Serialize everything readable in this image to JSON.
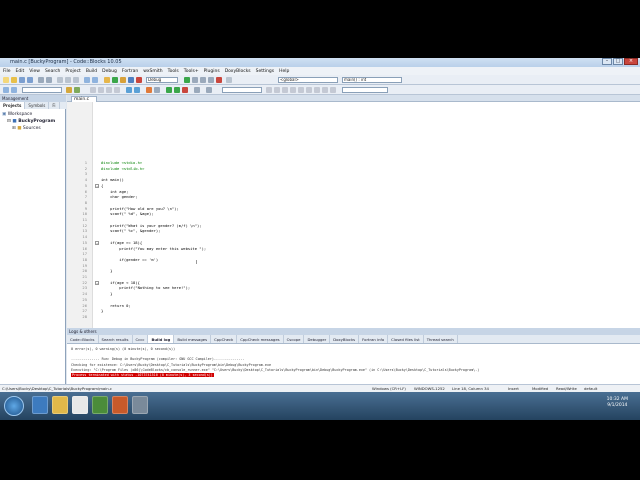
{
  "window": {
    "title": "main.c [BuckyProgram] - Code::Blocks 10.05"
  },
  "menu": [
    "File",
    "Edit",
    "View",
    "Search",
    "Project",
    "Build",
    "Debug",
    "Fortran",
    "wxSmith",
    "Tools",
    "Tools+",
    "Plugins",
    "DoxyBlocks",
    "Settings",
    "Help"
  ],
  "toolbar": {
    "build_target": "Debug",
    "scope": "<global>",
    "function": "main() : int"
  },
  "management": {
    "title": "Management",
    "tabs": [
      "Projects",
      "Symbols",
      "Fi"
    ],
    "workspace": "Workspace",
    "project": "BuckyProgram",
    "folder": "Sources"
  },
  "editor": {
    "file_tab": "main.c",
    "lines": [
      {
        "n": "1",
        "text": "#include <stdio.h>",
        "cls": "pp"
      },
      {
        "n": "2",
        "text": "#include <stdlib.h>",
        "cls": "pp"
      },
      {
        "n": "3",
        "text": "",
        "cls": ""
      },
      {
        "n": "4",
        "text": "int main()",
        "cls": ""
      },
      {
        "n": "5",
        "text": "{",
        "cls": ""
      },
      {
        "n": "6",
        "text": "    int age;",
        "cls": ""
      },
      {
        "n": "7",
        "text": "    char gender;",
        "cls": ""
      },
      {
        "n": "8",
        "text": "",
        "cls": ""
      },
      {
        "n": "9",
        "text": "    printf(\"How old are you? \\n\");",
        "cls": ""
      },
      {
        "n": "10",
        "text": "    scanf(\" %d\", &age);",
        "cls": ""
      },
      {
        "n": "11",
        "text": "",
        "cls": ""
      },
      {
        "n": "12",
        "text": "    printf(\"What is your gender? (m/f) \\n\");",
        "cls": ""
      },
      {
        "n": "13",
        "text": "    scanf(\" %c\", &gender);",
        "cls": ""
      },
      {
        "n": "14",
        "text": "",
        "cls": ""
      },
      {
        "n": "15",
        "text": "    if(age >= 18){",
        "cls": ""
      },
      {
        "n": "16",
        "text": "        printf(\"You may enter this website \");",
        "cls": ""
      },
      {
        "n": "17",
        "text": "",
        "cls": ""
      },
      {
        "n": "18",
        "text": "        if(gender == 'm')",
        "cls": ""
      },
      {
        "n": "19",
        "text": "",
        "cls": ""
      },
      {
        "n": "20",
        "text": "    }",
        "cls": ""
      },
      {
        "n": "21",
        "text": "",
        "cls": ""
      },
      {
        "n": "22",
        "text": "    if(age < 18){",
        "cls": ""
      },
      {
        "n": "23",
        "text": "        printf(\"Nothing to see here!\");",
        "cls": ""
      },
      {
        "n": "24",
        "text": "    }",
        "cls": ""
      },
      {
        "n": "25",
        "text": "",
        "cls": ""
      },
      {
        "n": "26",
        "text": "    return 0;",
        "cls": ""
      },
      {
        "n": "27",
        "text": "}",
        "cls": ""
      },
      {
        "n": "28",
        "text": "",
        "cls": ""
      }
    ]
  },
  "logs": {
    "title": "Logs & others",
    "tabs": [
      "Code::Blocks",
      "Search results",
      "Cccc",
      "Build log",
      "Build messages",
      "CppCheck",
      "CppCheck messages",
      "Cscope",
      "Debugger",
      "DoxyBlocks",
      "Fortran info",
      "Closed files list",
      "Thread search"
    ],
    "active_tab": "Build log",
    "lines": [
      "0 error(s), 0 warning(s) (0 minute(s), 0 second(s))",
      "",
      "-------------- Run: Debug in BuckyProgram (compiler: GNU GCC Compiler)---------------",
      "Checking for existence: C:\\Users\\Bucky\\Desktop\\C_Tutorials\\BuckyProgram\\bin\\Debug\\BuckyProgram.exe",
      "Executing: \"C:\\Program Files (x86)\\CodeBlocks/cb_console_runner.exe\" \"C:\\Users\\Bucky\\Desktop\\C_Tutorials\\BuckyProgram\\bin\\Debug\\BuckyProgram.exe\"  (in C:\\Users\\Bucky\\Desktop\\C_Tutorials\\BuckyProgram\\.)",
      "Process terminated with status -1073741510 (0 minute(s), 3 second(s))"
    ]
  },
  "status": {
    "path": "C:\\Users\\Bucky\\Desktop\\C_Tutorials\\BuckyProgram\\main.c",
    "eol": "Windows (CR+LF)",
    "encoding": "WINDOWS-1252",
    "position": "Line 18, Column 34",
    "insert": "Insert",
    "modified": "Modified",
    "rw": "Read/Write",
    "profile": "default"
  },
  "taskbar": {
    "time": "10:32 AM",
    "date": "9/1/2014"
  }
}
